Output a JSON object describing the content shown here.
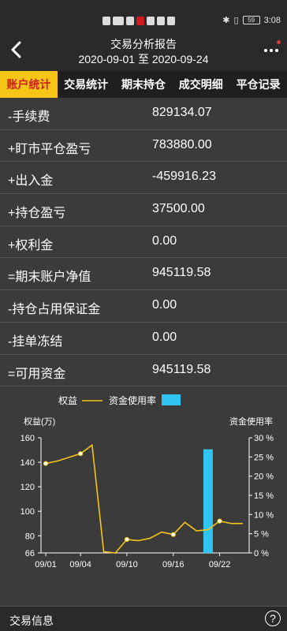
{
  "status": {
    "time": "3:08",
    "battery": "59"
  },
  "header": {
    "title": "交易分析报告",
    "date_range": "2020-09-01 至 2020-09-24"
  },
  "tabs": [
    {
      "label": "账户统计",
      "active": true
    },
    {
      "label": "交易统计",
      "active": false
    },
    {
      "label": "期末持仓",
      "active": false
    },
    {
      "label": "成交明细",
      "active": false
    },
    {
      "label": "平仓记录",
      "active": false
    }
  ],
  "rows": [
    {
      "label": "-手续费",
      "value": "829134.07"
    },
    {
      "label": "+盯市平仓盈亏",
      "value": "783880.00"
    },
    {
      "label": "+出入金",
      "value": "-459916.23"
    },
    {
      "label": "+持仓盈亏",
      "value": "37500.00"
    },
    {
      "label": "+权利金",
      "value": "0.00"
    },
    {
      "label": "=期末账户净值",
      "value": "945119.58"
    },
    {
      "label": "-持仓占用保证金",
      "value": "0.00"
    },
    {
      "label": "-挂单冻结",
      "value": "0.00"
    },
    {
      "label": "=可用资金",
      "value": "945119.58"
    }
  ],
  "chart_data": {
    "type": "line",
    "legend": [
      {
        "name": "权益",
        "color": "#f5c518",
        "style": "line"
      },
      {
        "name": "资金使用率",
        "color": "#2fc4f2",
        "style": "bar"
      }
    ],
    "ylabel_left": "权益(万)",
    "ylabel_right": "资金使用率",
    "y_left_ticks": [
      "160",
      "140",
      "120",
      "100",
      "80",
      "66"
    ],
    "y_right_ticks": [
      "30 %",
      "25 %",
      "20 %",
      "15 %",
      "10 %",
      "5 %",
      "0 %"
    ],
    "ylim_left": [
      66,
      160
    ],
    "ylim_right": [
      0,
      30
    ],
    "x_ticks": [
      "09/01",
      "09/04",
      "09/10",
      "09/16",
      "09/22"
    ],
    "series": [
      {
        "name": "权益",
        "axis": "left",
        "x": [
          "09/01",
          "09/02",
          "09/03",
          "09/04",
          "09/07",
          "09/08",
          "09/09",
          "09/10",
          "09/11",
          "09/14",
          "09/15",
          "09/16",
          "09/17",
          "09/18",
          "09/21",
          "09/22",
          "09/23",
          "09/24"
        ],
        "values": [
          139,
          141,
          144,
          147,
          154,
          67,
          66,
          77,
          76,
          78,
          83,
          81,
          91,
          84,
          85,
          92,
          90,
          90
        ],
        "markers": [
          "09/01",
          "09/04",
          "09/10",
          "09/16",
          "09/22"
        ]
      },
      {
        "name": "资金使用率",
        "axis": "right",
        "type": "bar",
        "x": [
          "09/21"
        ],
        "values": [
          27
        ]
      }
    ]
  },
  "bottom": {
    "label": "交易信息",
    "help": "?"
  }
}
